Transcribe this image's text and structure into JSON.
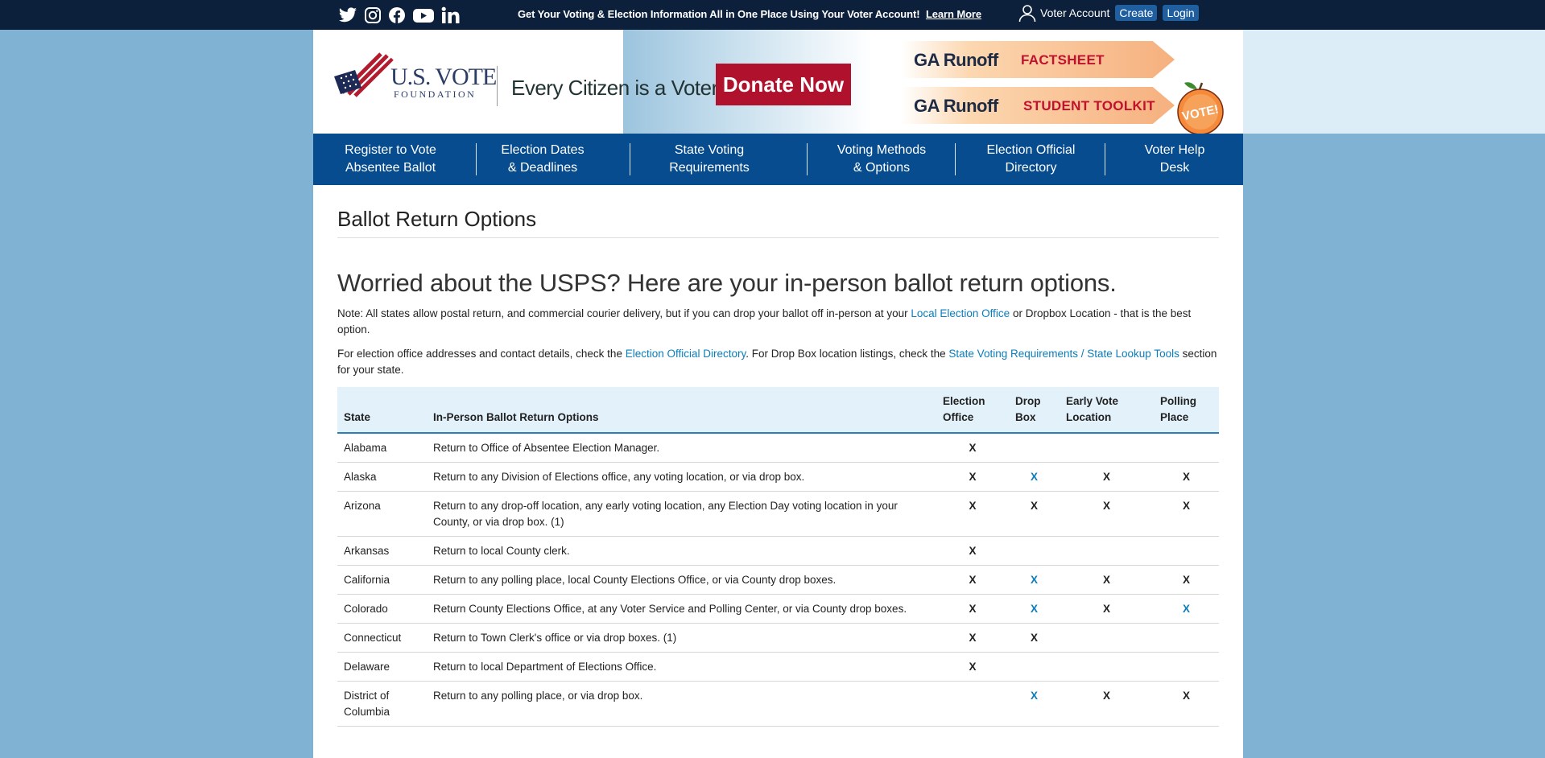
{
  "topbar": {
    "social_icons": [
      "twitter-icon",
      "instagram-icon",
      "facebook-icon",
      "youtube-icon",
      "linkedin-icon"
    ],
    "message": "Get Your Voting & Election Information All in One Place Using Your Voter Account!",
    "learn_more": "Learn More",
    "account_label": "Voter Account",
    "create_label": "Create",
    "login_label": "Login"
  },
  "header": {
    "logo_big": "U.S. VOTE",
    "logo_small": "FOUNDATION",
    "tagline": "Every Citizen is a Voter",
    "donate_label": "Donate Now",
    "banner1_left": "GA Runoff",
    "banner1_right": "FACTSHEET",
    "banner2_left": "GA Runoff",
    "banner2_right": "STUDENT TOOLKIT",
    "peach_text": "VOTE!"
  },
  "nav": [
    {
      "line1": "Register to Vote",
      "line2": "Absentee Ballot"
    },
    {
      "line1": "Election Dates",
      "line2": "& Deadlines"
    },
    {
      "line1": "State Voting",
      "line2": "Requirements"
    },
    {
      "line1": "Voting Methods",
      "line2": "& Options"
    },
    {
      "line1": "Election Official",
      "line2": "Directory"
    },
    {
      "line1": "Voter Help",
      "line2": "Desk"
    }
  ],
  "page": {
    "title": "Ballot Return Options",
    "heading": "Worried about the USPS? Here are your in-person ballot return options.",
    "note_a": "Note: All states allow postal return, and commercial courier delivery, but if you can drop your ballot off in-person at your ",
    "note_link": "Local Election Office",
    "note_b": " or Dropbox Location - that is the best option.",
    "info_a": "For election office addresses and contact details, check the ",
    "info_link1": "Election Official Directory",
    "info_b": ". For Drop Box location listings, check the ",
    "info_link2": "State Voting Requirements / State Lookup Tools",
    "info_c": " section for your state."
  },
  "table": {
    "headers": [
      "State",
      "In-Person Ballot Return Options",
      "Election Office",
      "Drop Box",
      "Early Vote Location",
      "Polling Place"
    ],
    "header_lines": {
      "election_office": [
        "Election",
        "Office"
      ],
      "drop_box": [
        "Drop",
        "Box"
      ],
      "early_vote": [
        "Early Vote",
        "Location"
      ],
      "polling_place": [
        "Polling",
        "Place"
      ]
    },
    "rows": [
      {
        "state": "Alabama",
        "options": "Return to Office of Absentee Election Manager.",
        "office": "X",
        "dropbox": "",
        "early": "",
        "polling": ""
      },
      {
        "state": "Alaska",
        "options": "Return to any Division of Elections office, any voting location, or via drop box.",
        "office": "X",
        "dropbox": "X",
        "early": "X",
        "polling": "X"
      },
      {
        "state": "Arizona",
        "options": "Return to any drop-off location, any early voting location, any Election Day voting location in your County, or via drop box. (1)",
        "office": "X",
        "dropbox": "X",
        "early": "X",
        "polling": "X"
      },
      {
        "state": "Arkansas",
        "options": "Return to local County clerk.",
        "office": "X",
        "dropbox": "",
        "early": "",
        "polling": ""
      },
      {
        "state": "California",
        "options": "Return to any polling place, local County Elections Office, or via County drop boxes.",
        "office": "X",
        "dropbox": "X",
        "early": "X",
        "polling": "X"
      },
      {
        "state": "Colorado",
        "options": "Return County Elections Office, at any Voter Service and Polling Center, or via County drop boxes.",
        "office": "X",
        "dropbox": "X",
        "early": "X",
        "polling": "X"
      },
      {
        "state": "Connecticut",
        "options": "Return to Town Clerk's office or via drop boxes. (1)",
        "office": "X",
        "dropbox": "X",
        "early": "",
        "polling": ""
      },
      {
        "state": "Delaware",
        "options": "Return to local Department of Elections Office.",
        "office": "X",
        "dropbox": "",
        "early": "",
        "polling": ""
      },
      {
        "state": "District of Columbia",
        "options": "Return to any polling place, or via drop box.",
        "office": "",
        "dropbox": "X",
        "early": "X",
        "polling": "X"
      }
    ],
    "link_marks": [
      [
        1,
        "dropbox"
      ],
      [
        4,
        "dropbox"
      ],
      [
        5,
        "dropbox"
      ],
      [
        5,
        "polling"
      ],
      [
        8,
        "dropbox"
      ]
    ]
  },
  "colors": {
    "topbar": "#0c1f3b",
    "nav": "#074c8e",
    "page_bg": "#7fb2d3",
    "link": "#0b7dbb",
    "donate": "#b0122e"
  }
}
